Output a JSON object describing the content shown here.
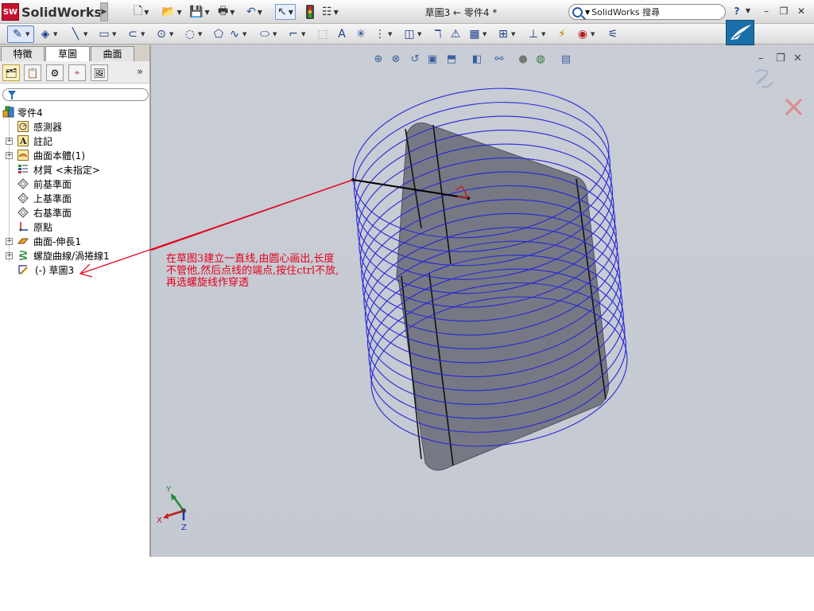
{
  "app": {
    "brand": "SolidWorks",
    "brand_badge": "SW",
    "window_title": "草圖3 ← 零件4 *",
    "search_placeholder": "SolidWorks 搜尋"
  },
  "manager_tabs": [
    {
      "label": "特徵",
      "active": false
    },
    {
      "label": "草圖",
      "active": true
    },
    {
      "label": "曲面",
      "active": false
    }
  ],
  "feature_tree": {
    "root": "零件4",
    "items": [
      {
        "label": "感測器",
        "icon": "sensor-icon",
        "expandable": false
      },
      {
        "label": "註記",
        "icon": "annotations-icon",
        "expandable": true
      },
      {
        "label": "曲面本體(1)",
        "icon": "surface-bodies-icon",
        "expandable": true
      },
      {
        "label": "材質 <未指定>",
        "icon": "material-icon",
        "expandable": false
      },
      {
        "label": "前基準面",
        "icon": "plane-icon",
        "expandable": false
      },
      {
        "label": "上基準面",
        "icon": "plane-icon",
        "expandable": false
      },
      {
        "label": "右基準面",
        "icon": "plane-icon",
        "expandable": false
      },
      {
        "label": "原點",
        "icon": "origin-icon",
        "expandable": false
      },
      {
        "label": "曲面-伸長1",
        "icon": "surface-extrude-icon",
        "expandable": true
      },
      {
        "label": "螺旋曲線/渦捲線1",
        "icon": "helix-icon",
        "expandable": true
      },
      {
        "label": "(-) 草圖3",
        "icon": "sketch-icon",
        "expandable": false
      }
    ]
  },
  "annotation": {
    "text": "在草图3建立一直线,由圆心画出,长度不管他,然后点线的端点,按住ctrl不放,再选螺旋线作穿透"
  },
  "triad": {
    "x": "X",
    "y": "Y",
    "z": "Z"
  },
  "colors": {
    "helix": "#2727d8",
    "surface": "#6b6e78",
    "annotation": "#e4001b",
    "viewport_bg": "#c6cad3"
  }
}
